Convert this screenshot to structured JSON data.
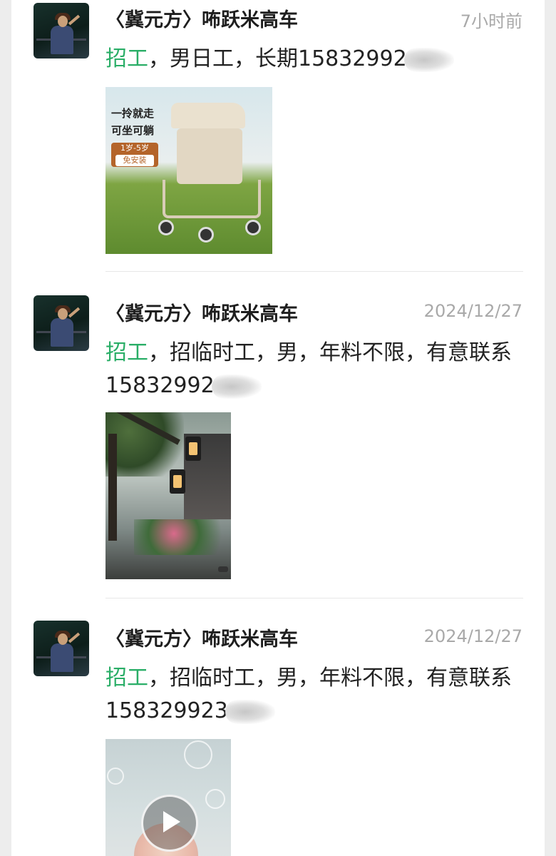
{
  "feed": [
    {
      "author": "〈冀元方〉咘跃米高车",
      "time": "7小时前",
      "highlight": "招工",
      "text": "，男日工，长期15832992",
      "image": "stroller-photo",
      "image_text": {
        "line1": "一拎就走",
        "line2": "可坐可躺",
        "badge_top": "1岁-5岁",
        "badge_bottom": "免安装"
      }
    },
    {
      "author": "〈冀元方〉咘跃米高车",
      "time": "2024/12/27",
      "highlight": "招工",
      "text": "，招临时工，男，年料不限，有意联系15832992",
      "image": "lantern-photo"
    },
    {
      "author": "〈冀元方〉咘跃米高车",
      "time": "2024/12/27",
      "highlight": "招工",
      "text": "，招临时工，男，年料不限，有意联系158329923",
      "image": "video-thumbnail"
    }
  ],
  "icons": {
    "play": "play-icon",
    "avatar": "avatar-image"
  },
  "colors": {
    "highlight": "#2aae67",
    "background": "#ededed",
    "panel": "#ffffff",
    "time": "#a9a9a9"
  }
}
